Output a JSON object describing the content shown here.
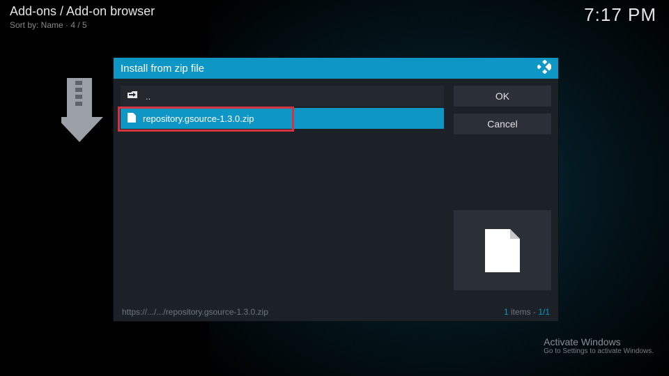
{
  "header": {
    "breadcrumb": "Add-ons / Add-on browser",
    "sort_prefix": "Sort by: Name",
    "sort_count": "4 / 5",
    "time": "7:17 PM"
  },
  "dialog": {
    "title": "Install from zip file",
    "parent_label": "..",
    "items": [
      {
        "icon": "file",
        "name": "repository.gsource-1.3.0.zip",
        "selected": true
      }
    ],
    "buttons": {
      "ok": "OK",
      "cancel": "Cancel"
    },
    "footer_path": "https://.../.../repository.gsource-1.3.0.zip",
    "footer_count_num": "1",
    "footer_count_label": " items - ",
    "footer_page": "1/1"
  },
  "watermark": {
    "line1": "Activate Windows",
    "line2": "Go to Settings to activate Windows."
  }
}
